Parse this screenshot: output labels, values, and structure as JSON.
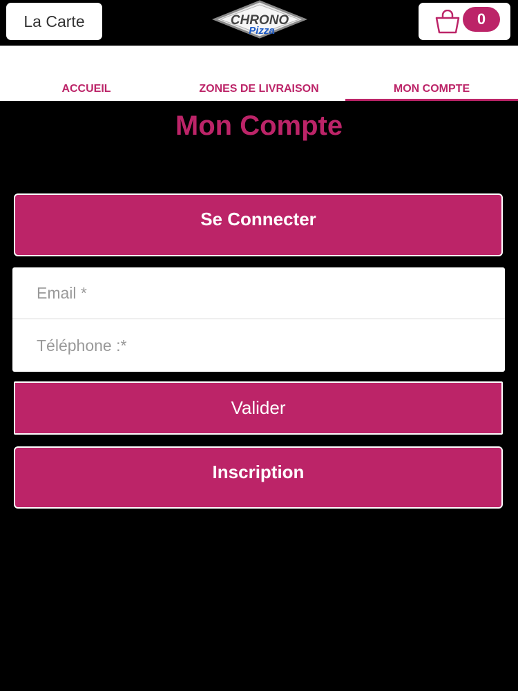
{
  "header": {
    "menu_label": "La Carte",
    "logo_text_top": "CHRONO",
    "logo_text_bottom": "Pizza",
    "cart_count": "0"
  },
  "tabs": [
    {
      "label": "ACCUEIL"
    },
    {
      "label": "ZONES DE LIVRAISON"
    },
    {
      "label": "MON COMPTE",
      "active": true
    }
  ],
  "page": {
    "title": "Mon Compte",
    "connect_label": "Se Connecter",
    "email_placeholder": "Email *",
    "phone_placeholder": "Téléphone :*",
    "submit_label": "Valider",
    "register_label": "Inscription"
  },
  "colors": {
    "accent": "#bc2468",
    "background": "#000000",
    "logo_blue": "#1e5bc6"
  },
  "icons": {
    "cart": "shopping-bag-icon",
    "logo": "chrono-pizza-logo"
  }
}
